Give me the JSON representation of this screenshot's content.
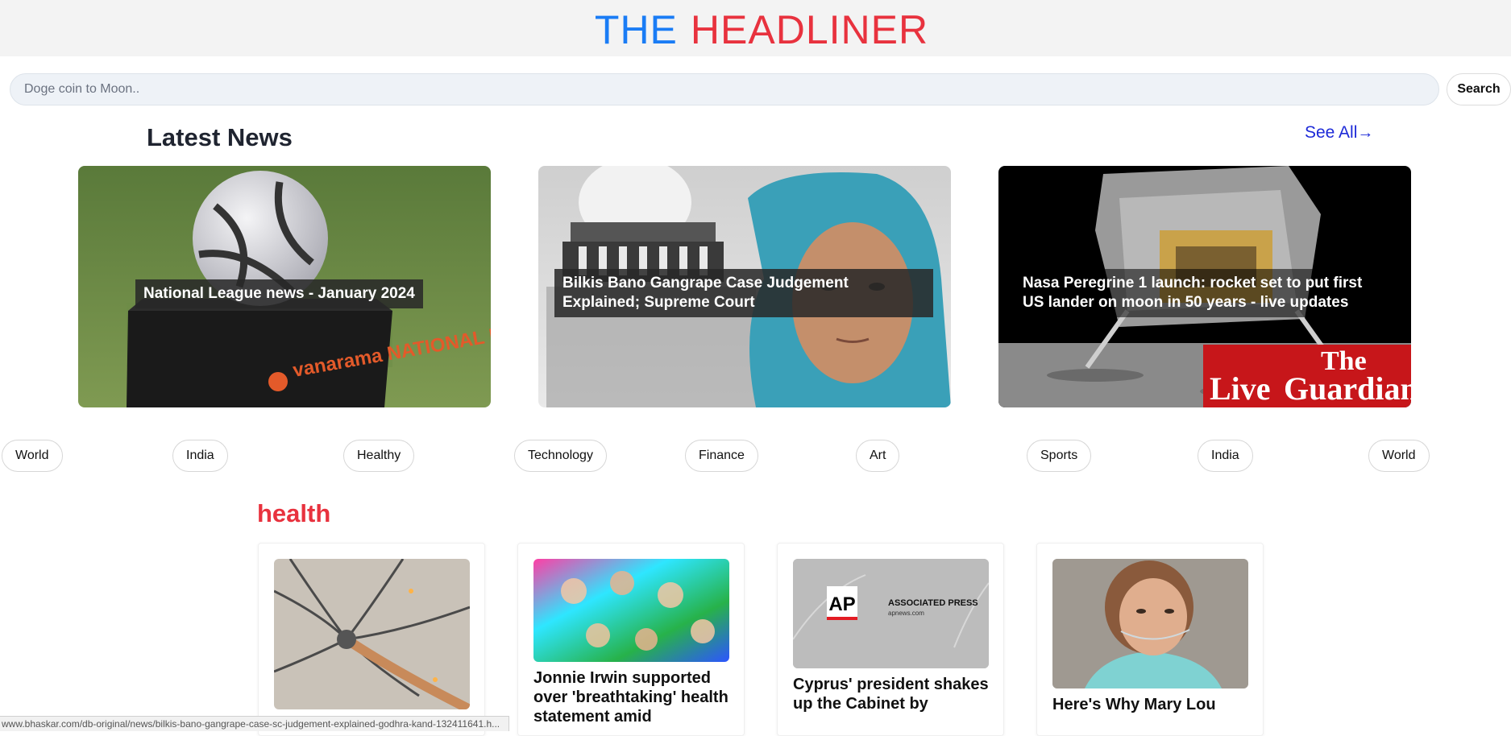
{
  "header": {
    "logo_the": "THE",
    "logo_name": "HEADLINER",
    "the_color": "#1a7cf5",
    "name_color": "#e8323e"
  },
  "search": {
    "placeholder": "Doge coin to Moon..",
    "button_label": "Search"
  },
  "latest": {
    "title": "Latest News",
    "see_all_label": "See All",
    "see_all_icon": "arrow-right-icon",
    "cards": [
      {
        "caption": "National League news - January 2024",
        "image": "football-trophy-ball-photo",
        "image_text": "vanarama NATIONAL LEAGUE"
      },
      {
        "caption": "Bilkis Bano Gangrape Case Judgement Explained; Supreme Court",
        "image": "supreme-court-woman-photo"
      },
      {
        "caption": "Nasa Peregrine 1 launch: rocket set to put first US lander on moon in 50 years - live updates",
        "image": "lunar-lander-photo",
        "image_text": [
          "The",
          "Live",
          "Guardian"
        ]
      }
    ]
  },
  "categories": [
    "World",
    "India",
    "Healthy",
    "Technology",
    "Finance",
    "Art",
    "Sports",
    "India",
    "World"
  ],
  "section": {
    "title": "health",
    "cards": [
      {
        "title": "",
        "image": "neurons-photo"
      },
      {
        "title": "Jonnie Irwin supported over 'breathtaking' health statement amid",
        "image": "colorful-group-photo"
      },
      {
        "title": "Cyprus' president shakes up the Cabinet by",
        "image": "ap-logo-placeholder",
        "image_text": [
          "AP",
          "ASSOCIATED PRESS",
          "apnews.com"
        ]
      },
      {
        "title": "Here's Why Mary Lou",
        "image": "woman-portrait-photo"
      }
    ]
  },
  "status_url": "www.bhaskar.com/db-original/news/bilkis-bano-gangrape-case-sc-judgement-explained-godhra-kand-132411641.h..."
}
